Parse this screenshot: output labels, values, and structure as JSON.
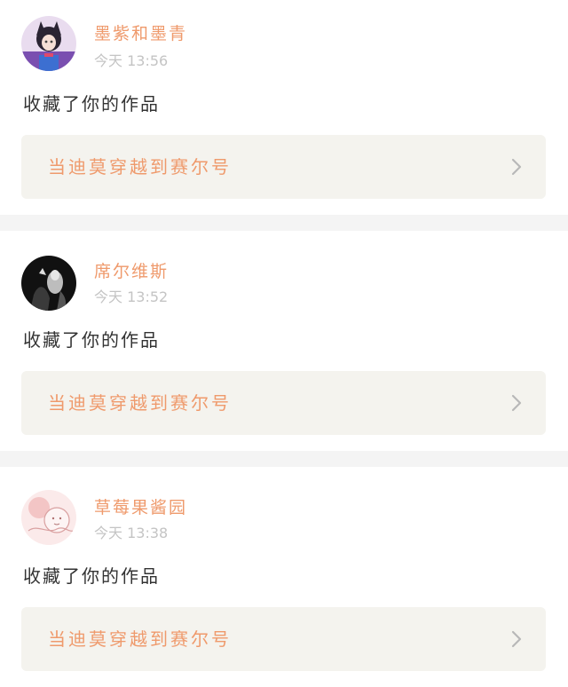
{
  "notifications": [
    {
      "username": "墨紫和墨青",
      "time": "今天 13:56",
      "action": "收藏了你的作品",
      "work_title": "当迪莫穿越到赛尔号",
      "avatar_icon": "anime-girl-avatar"
    },
    {
      "username": "席尔维斯",
      "time": "今天 13:52",
      "action": "收藏了你的作品",
      "work_title": "当迪莫穿越到赛尔号",
      "avatar_icon": "dark-figure-avatar"
    },
    {
      "username": "草莓果酱园",
      "time": "今天 13:38",
      "action": "收藏了你的作品",
      "work_title": "当迪莫穿越到赛尔号",
      "avatar_icon": "pink-sketch-avatar"
    }
  ],
  "colors": {
    "accent": "#ef9a6c",
    "time": "#c4c4c4",
    "card_bg": "#f4f3ee",
    "separator": "#f4f4f4"
  }
}
